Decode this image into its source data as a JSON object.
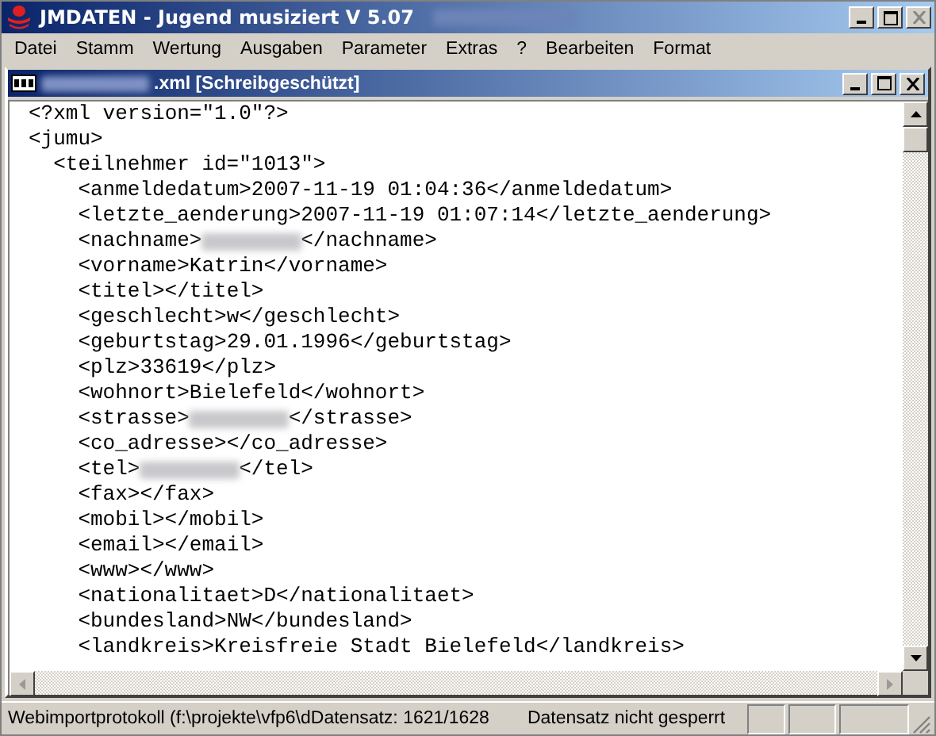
{
  "window": {
    "title": "JMDATEN - Jugend musiziert  V 5.07",
    "title_blurred": true
  },
  "menu": [
    "Datei",
    "Stamm",
    "Wertung",
    "Ausgaben",
    "Parameter",
    "Extras",
    "?",
    "Bearbeiten",
    "Format"
  ],
  "document": {
    "title_blurred": true,
    "title": ".xml [Schreibgeschützt]",
    "lines": [
      {
        "text": "<?xml version=\"1.0\"?>"
      },
      {
        "text": "<jumu>",
        "children": [
          {
            "text": "<teilnehmer id=\"1013\">",
            "children": [
              {
                "text": "<anmeldedatum>2007-11-19 01:04:36</anmeldedatum>"
              },
              {
                "text": "<letzte_aenderung>2007-11-19 01:07:14</letzte_aenderung>"
              },
              {
                "text": "<nachname>",
                "blurred": true,
                "after": "</nachname>"
              },
              {
                "text": "<vorname>Katrin</vorname>"
              },
              {
                "text": "<titel></titel>"
              },
              {
                "text": "<geschlecht>w</geschlecht>"
              },
              {
                "text": "<geburtstag>29.01.1996</geburtstag>"
              },
              {
                "text": "<plz>33619</plz>"
              },
              {
                "text": "<wohnort>Bielefeld</wohnort>"
              },
              {
                "text": "<strasse>",
                "blurred": true,
                "after": "</strasse>"
              },
              {
                "text": "<co_adresse></co_adresse>"
              },
              {
                "text": "<tel>",
                "blurred": true,
                "after": "</tel>"
              },
              {
                "text": "<fax></fax>"
              },
              {
                "text": "<mobil></mobil>"
              },
              {
                "text": "<email></email>"
              },
              {
                "text": "<www></www>"
              },
              {
                "text": "<nationalitaet>D</nationalitaet>"
              },
              {
                "text": "<bundesland>NW</bundesland>"
              },
              {
                "text": "<landkreis>Kreisfreie Stadt Bielefeld</landkreis>"
              }
            ]
          }
        ]
      }
    ]
  },
  "status_bar": {
    "panels": [
      "Webimportprotokoll (f:\\projekte\\vfp6\\d",
      "Datensatz: 1621/1628",
      "Datensatz nicht gesperrt"
    ]
  }
}
